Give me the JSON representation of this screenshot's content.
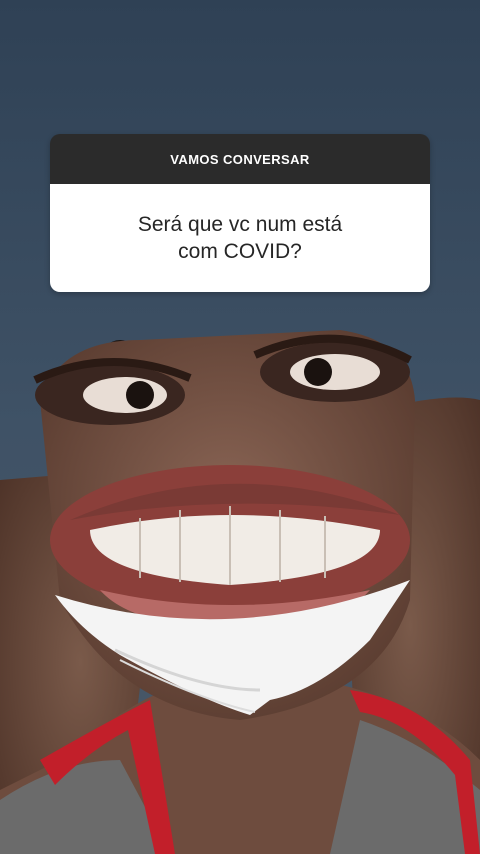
{
  "sticker": {
    "title": "VAMOS CONVERSAR",
    "question": "Será que vc num está com COVID?"
  }
}
